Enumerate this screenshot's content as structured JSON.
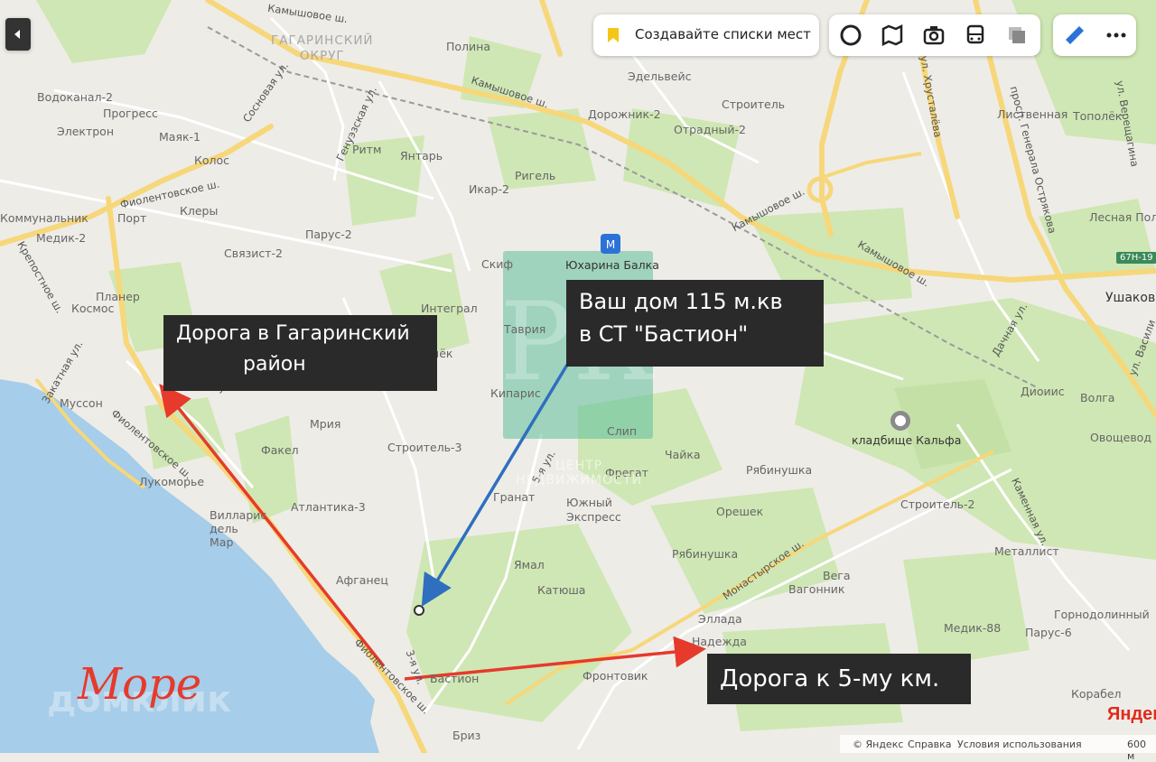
{
  "toolbar": {
    "collapse_icon": "chevron-left-icon",
    "create_lists_label": "Создавайте списки мест",
    "bookmark_icon": "bookmark-icon",
    "layers": [
      "panorama-icon",
      "map-layers-icon",
      "camera-icon",
      "transit-icon",
      "layers-icon"
    ],
    "ruler_icon": "ruler-icon",
    "more_icon": "more-icon"
  },
  "districts": {
    "gagarinsky": "ГАГАРИНСКИЙ\nОКРУГ"
  },
  "places": [
    "Полина",
    "Эдельвейс",
    "Дорожник-2",
    "Строитель",
    "Отрадный-2",
    "Водоканал-2",
    "Прогресс",
    "Электрон",
    "Маяк-1",
    "Колос",
    "Ритм",
    "Янтарь",
    "Ригель",
    "Икар-2",
    "Клеры",
    "Порт",
    "Медик-2",
    "Парус-2",
    "Связист-2",
    "Скиф",
    "Интеграл",
    "Планер",
    "Космос",
    "Таврия",
    "Огонёк",
    "Кипарис",
    "Мрия",
    "Слип",
    "Строитель-3",
    "Факел",
    "Лукоморье",
    "Вилларис дель Мар",
    "Атлантика-3",
    "Гранат",
    "Фрегат",
    "Южный Экспресс",
    "Чайка",
    "Рябинушка",
    "Орешек",
    "Ямал",
    "Рябинушка",
    "Катюша",
    "Афганец",
    "Эллада",
    "Надежда",
    "Фронтовик",
    "Бастион",
    "Бриз",
    "Вега",
    "Вагонник",
    "Медик-88",
    "Парус-6",
    "Горнодолинный",
    "Металлист",
    "Строитель-2",
    "Овощевод",
    "Диоиис",
    "Волга",
    "Тополёк",
    "Лесная Поляна",
    "Ушаков",
    "Корабел",
    "Муссон",
    "Наука",
    "Коммунальник",
    "Лиственная"
  ],
  "streets": [
    "Камышовое ш.",
    "Камышовое ш.",
    "Камышовое ш.",
    "Камышовое ш.",
    "Генуэзская ул.",
    "Сосновая ул.",
    "Фиолентовское ш.",
    "Фиолентовское ш.",
    "Фиолентовское ш.",
    "Крепостное ш.",
    "Закатная ул.",
    "Монастырское ш.",
    "5-я ул.",
    "3-я ул.",
    "ул. Хрусталёва",
    "просп. Генерала Острякова",
    "ул. Верещагина",
    "Дачная ул.",
    "Каменная ул.",
    "ул. Васили"
  ],
  "metro": {
    "name": "Юхарина Балка",
    "icon": "transit-stop-icon"
  },
  "poi": {
    "name": "кладбище Кальфа",
    "icon": "cemetery-icon"
  },
  "road_badge": "67Н-19",
  "callouts": {
    "house": [
      "Ваш дом 115 м.кв",
      "в СТ \"Бастион\""
    ],
    "gagarin_road": [
      "Дорога в Гагаринский",
      "район"
    ],
    "km5_road": "Дорога к 5-му км.",
    "sea": "Море"
  },
  "watermarks": {
    "top": "ЦЕНТР НЕДВИЖИМОСТИ",
    "logo": "РК",
    "bottom": "домклик"
  },
  "attribution": {
    "copyright": "© Яндекс",
    "help": "Справка",
    "terms": "Условия использования",
    "scale": "600 м",
    "brand": "Яндекс"
  },
  "colors": {
    "water": "#a6cde9",
    "park": "#cfe7b4",
    "road_major": "#f6d77a",
    "arrow_red": "#e53a2c",
    "arrow_blue": "#2f6fbf",
    "callout_bg": "#2a2a2a",
    "marker_green": "#5fbf9c"
  }
}
